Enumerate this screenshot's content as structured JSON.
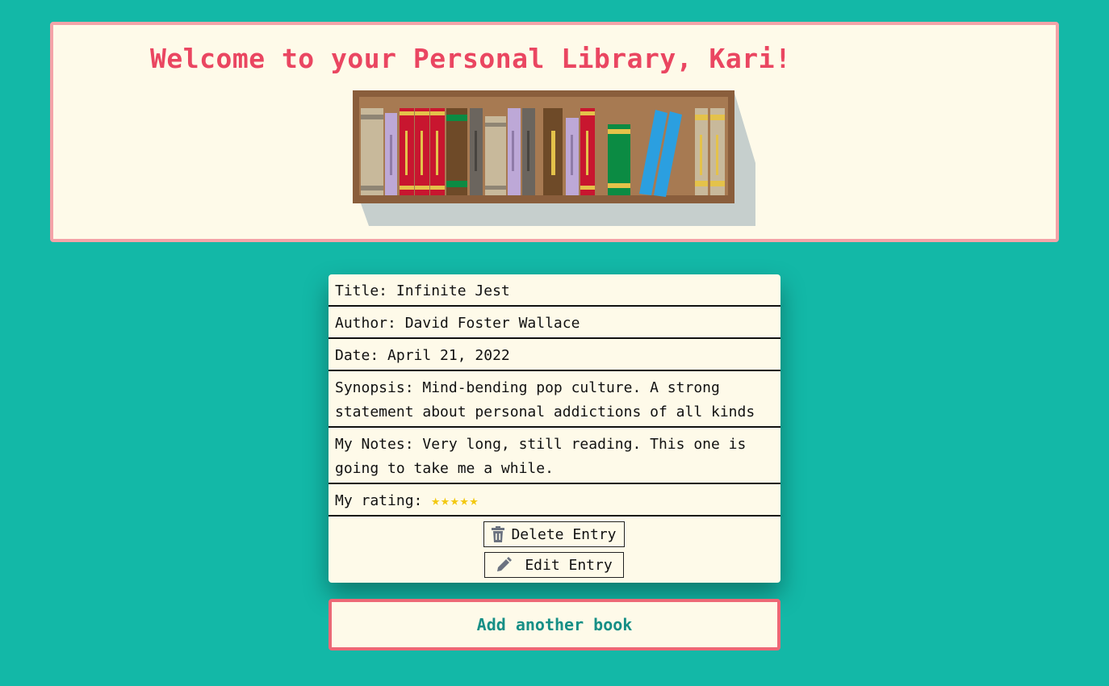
{
  "header": {
    "title": "Welcome to your Personal Library, Kari!",
    "image": "bookshelf-illustration"
  },
  "entry": {
    "title": "Title: Infinite Jest",
    "author": "Author: David Foster Wallace",
    "date": "Date: April 21, 2022",
    "synopsis_line1": "Synopsis: Mind-bending pop culture. A strong",
    "synopsis_line2": "statement about personal addictions of all kinds",
    "notes_line1": "My Notes: Very long, still reading. This one is",
    "notes_line2": "going to take me a while.",
    "rating_label": "My rating:",
    "rating_stars": "★★★★★",
    "rating_value": 5,
    "rating_max": 5
  },
  "buttons": {
    "delete_label": "Delete Entry",
    "delete_icon": "trash-icon",
    "edit_label": "Edit Entry",
    "edit_icon": "pencil-icon",
    "add_label": "Add another book"
  },
  "colors": {
    "background": "#13b8a7",
    "panel": "#fefae9",
    "title": "#ea4661",
    "header_border": "#f4a3a8",
    "add_border": "#ee6876",
    "add_text": "#168f86",
    "star": "#f2c811"
  }
}
